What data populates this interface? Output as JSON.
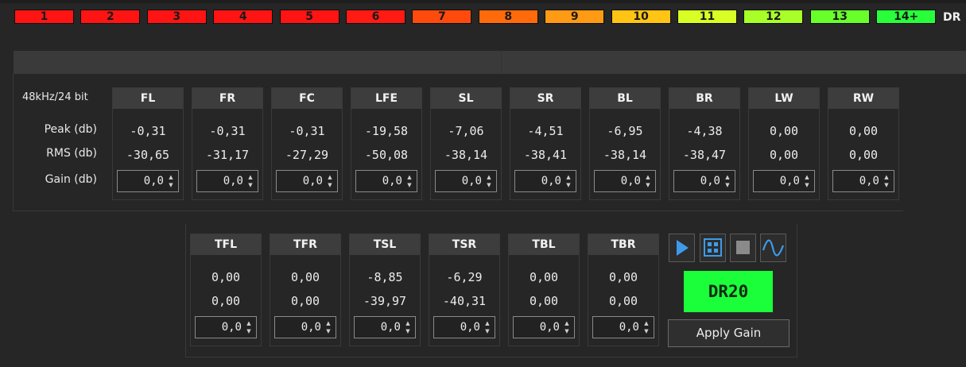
{
  "dr_scale": {
    "cells": [
      {
        "label": "1",
        "color": "#ff1414"
      },
      {
        "label": "2",
        "color": "#ff1414"
      },
      {
        "label": "3",
        "color": "#ff1414"
      },
      {
        "label": "4",
        "color": "#ff1414"
      },
      {
        "label": "5",
        "color": "#ff1414"
      },
      {
        "label": "6",
        "color": "#ff1a14"
      },
      {
        "label": "7",
        "color": "#ff4a0e"
      },
      {
        "label": "8",
        "color": "#ff6a0a"
      },
      {
        "label": "9",
        "color": "#ff9a14"
      },
      {
        "label": "10",
        "color": "#ffc414"
      },
      {
        "label": "11",
        "color": "#d8ff24"
      },
      {
        "label": "12",
        "color": "#a8ff28"
      },
      {
        "label": "13",
        "color": "#68ff2a"
      },
      {
        "label": "14+",
        "color": "#28ff3a"
      }
    ],
    "suffix": "DR"
  },
  "format_label": "48kHz/24 bit",
  "row_labels": {
    "peak": "Peak (db)",
    "rms": "RMS (db)",
    "gain": "Gain (db)"
  },
  "channels_main": [
    {
      "name": "FL",
      "peak": "-0,31",
      "rms": "-30,65",
      "gain": "0,0"
    },
    {
      "name": "FR",
      "peak": "-0,31",
      "rms": "-31,17",
      "gain": "0,0"
    },
    {
      "name": "FC",
      "peak": "-0,31",
      "rms": "-27,29",
      "gain": "0,0"
    },
    {
      "name": "LFE",
      "peak": "-19,58",
      "rms": "-50,08",
      "gain": "0,0"
    },
    {
      "name": "SL",
      "peak": "-7,06",
      "rms": "-38,14",
      "gain": "0,0"
    },
    {
      "name": "SR",
      "peak": "-4,51",
      "rms": "-38,41",
      "gain": "0,0"
    },
    {
      "name": "BL",
      "peak": "-6,95",
      "rms": "-38,14",
      "gain": "0,0"
    },
    {
      "name": "BR",
      "peak": "-4,38",
      "rms": "-38,47",
      "gain": "0,0"
    },
    {
      "name": "LW",
      "peak": "0,00",
      "rms": "0,00",
      "gain": "0,0"
    },
    {
      "name": "RW",
      "peak": "0,00",
      "rms": "0,00",
      "gain": "0,0"
    }
  ],
  "channels_top": [
    {
      "name": "TFL",
      "peak": "0,00",
      "rms": "0,00",
      "gain": "0,0"
    },
    {
      "name": "TFR",
      "peak": "0,00",
      "rms": "0,00",
      "gain": "0,0"
    },
    {
      "name": "TSL",
      "peak": "-8,85",
      "rms": "-39,97",
      "gain": "0,0"
    },
    {
      "name": "TSR",
      "peak": "-6,29",
      "rms": "-40,31",
      "gain": "0,0"
    },
    {
      "name": "TBL",
      "peak": "0,00",
      "rms": "0,00",
      "gain": "0,0"
    },
    {
      "name": "TBR",
      "peak": "0,00",
      "rms": "0,00",
      "gain": "0,0"
    }
  ],
  "transport": {
    "play_icon": "play-icon",
    "grid_icon": "grid-icon",
    "stop_icon": "stop-icon",
    "wave_icon": "waveform-icon",
    "accent": "#3d9be9"
  },
  "result": {
    "dr_value": "DR20",
    "color": "#1bff3a"
  },
  "apply_gain_label": "Apply Gain"
}
